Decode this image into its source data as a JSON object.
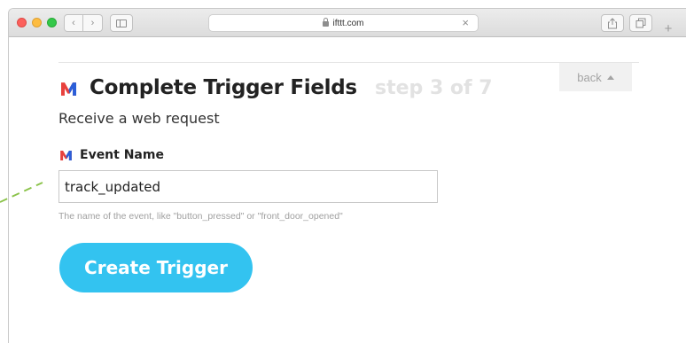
{
  "browser": {
    "address": "ifttt.com",
    "back_glyph": "‹",
    "forward_glyph": "›",
    "clear_glyph": "×",
    "new_tab_glyph": "+"
  },
  "page": {
    "title": "Complete Trigger Fields",
    "step": "step 3 of 7",
    "back_label": "back",
    "subtitle": "Receive a web request",
    "field": {
      "label": "Event Name",
      "value": "track_updated",
      "hint": "The name of the event, like \"button_pressed\" or \"front_door_opened\""
    },
    "create_label": "Create Trigger"
  },
  "colors": {
    "accent": "#33c3f0",
    "maker_red": "#e8413d",
    "maker_blue": "#2b5fd9",
    "annotation": "#8bc34a"
  },
  "icons": {
    "logo": "maker-webhooks-icon",
    "lock": "lock-icon",
    "share": "share-icon",
    "tabs": "tabs-icon",
    "sidebar": "sidebar-icon"
  }
}
